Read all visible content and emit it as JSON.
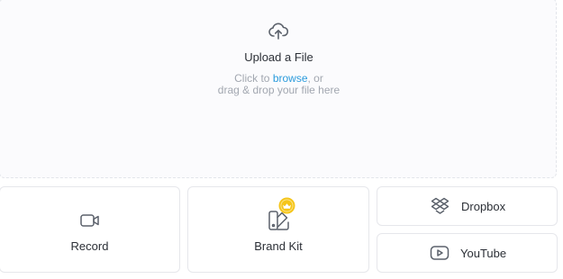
{
  "upload": {
    "title": "Upload a File",
    "hint_prefix": "Click to ",
    "browse_label": "browse",
    "hint_suffix": ", or",
    "hint_line2": "drag & drop your file here"
  },
  "sources": {
    "record_label": "Record",
    "brand_kit_label": "Brand Kit",
    "dropbox_label": "Dropbox",
    "youtube_label": "YouTube"
  },
  "colors": {
    "accent_link": "#2a9bdc",
    "badge": "#f5c518",
    "icon": "#5b616b"
  },
  "icons": {
    "upload": "cloud-upload-icon",
    "record": "video-camera-icon",
    "brand_kit": "swatch-book-icon",
    "brand_kit_badge": "crown-badge-icon",
    "dropbox": "dropbox-icon",
    "youtube": "youtube-icon"
  }
}
